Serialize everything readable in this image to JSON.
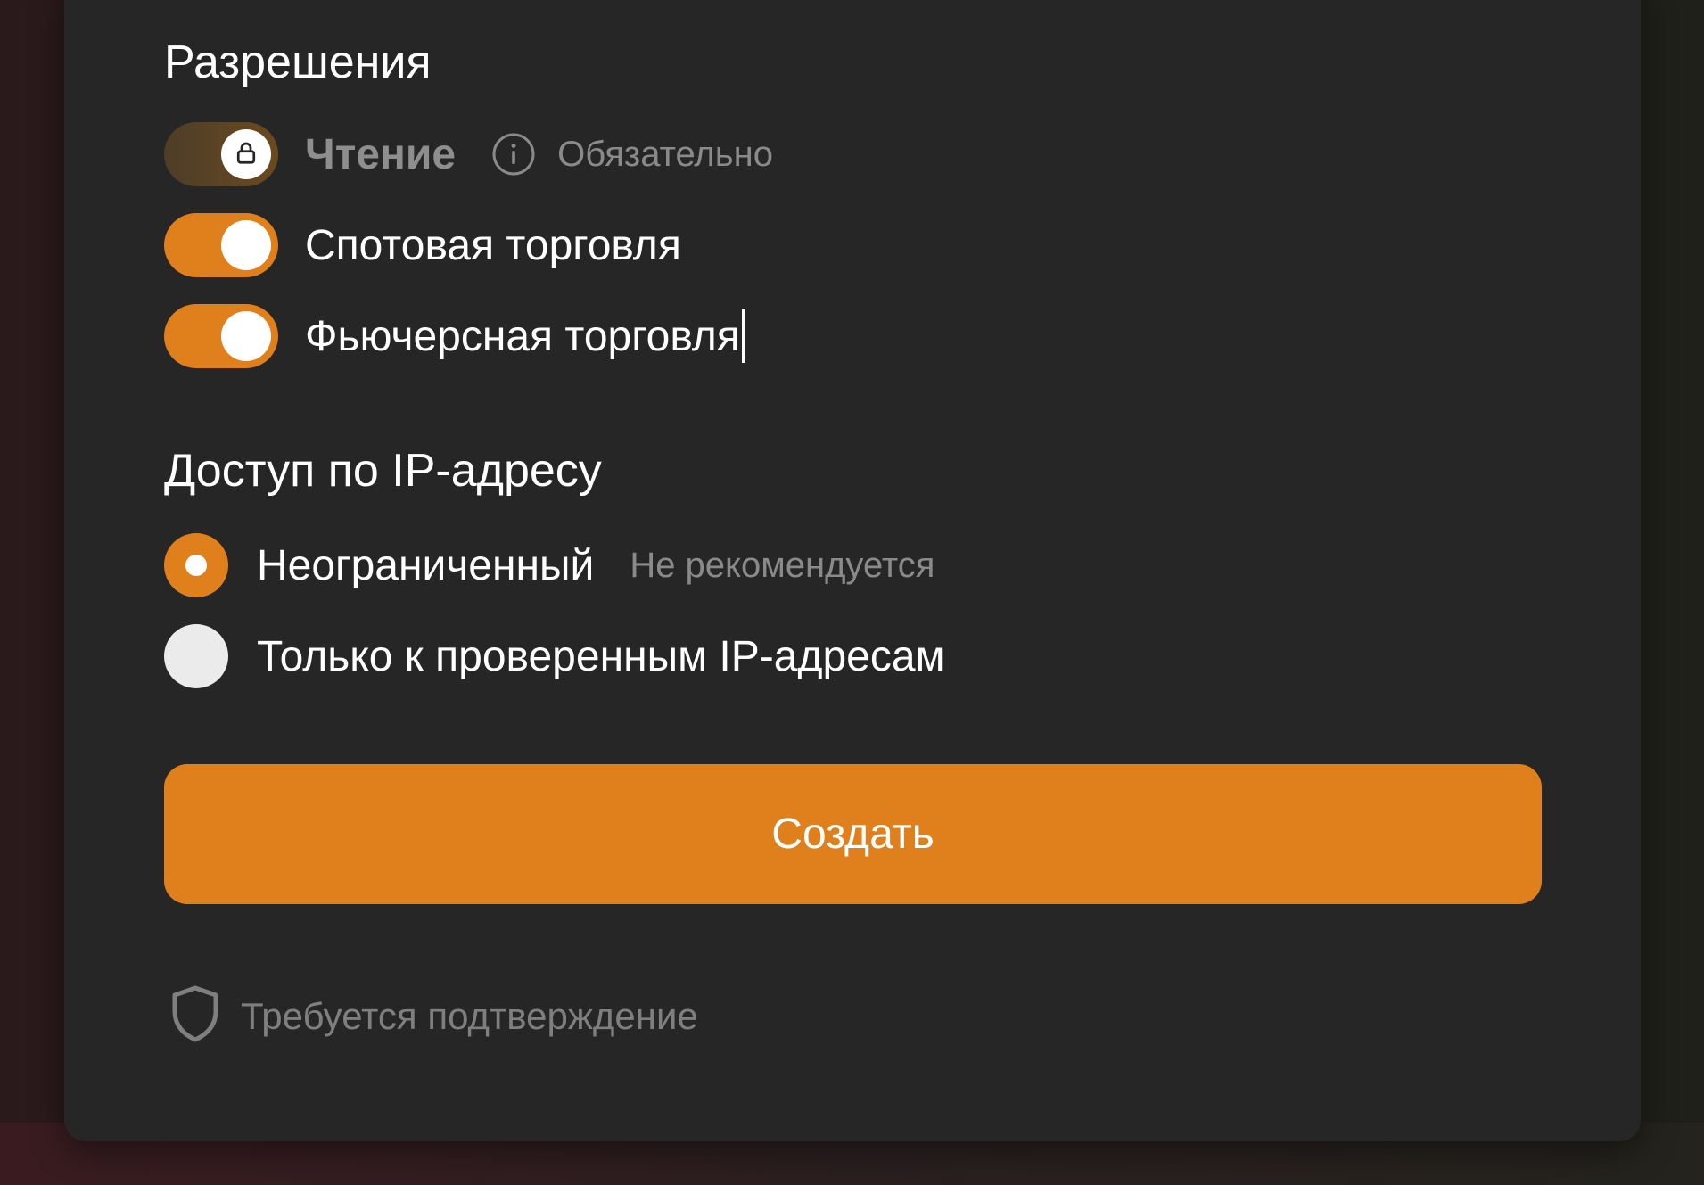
{
  "permissions": {
    "title": "Разрешения",
    "read": {
      "label": "Чтение",
      "hint": "Обязательно",
      "state": "on-locked",
      "lock_icon": "lock-icon",
      "info_icon": "info-icon"
    },
    "spot": {
      "label": "Спотовая торговля",
      "state": "on"
    },
    "futures": {
      "label": "Фьючерсная торговля",
      "state": "on"
    }
  },
  "ip_access": {
    "title": "Доступ по IP-адресу",
    "options": [
      {
        "label": "Неограниченный",
        "hint": "Не рекомендуется",
        "selected": true
      },
      {
        "label": "Только к проверенным IP-адресам",
        "selected": false
      }
    ]
  },
  "actions": {
    "create_label": "Создать"
  },
  "footer": {
    "confirm_text": "Требуется подтверждение",
    "confirm_icon": "shield-icon"
  },
  "colors": {
    "accent": "#df801c",
    "card_background": "#262626",
    "muted_text": "#8a8a8a"
  }
}
